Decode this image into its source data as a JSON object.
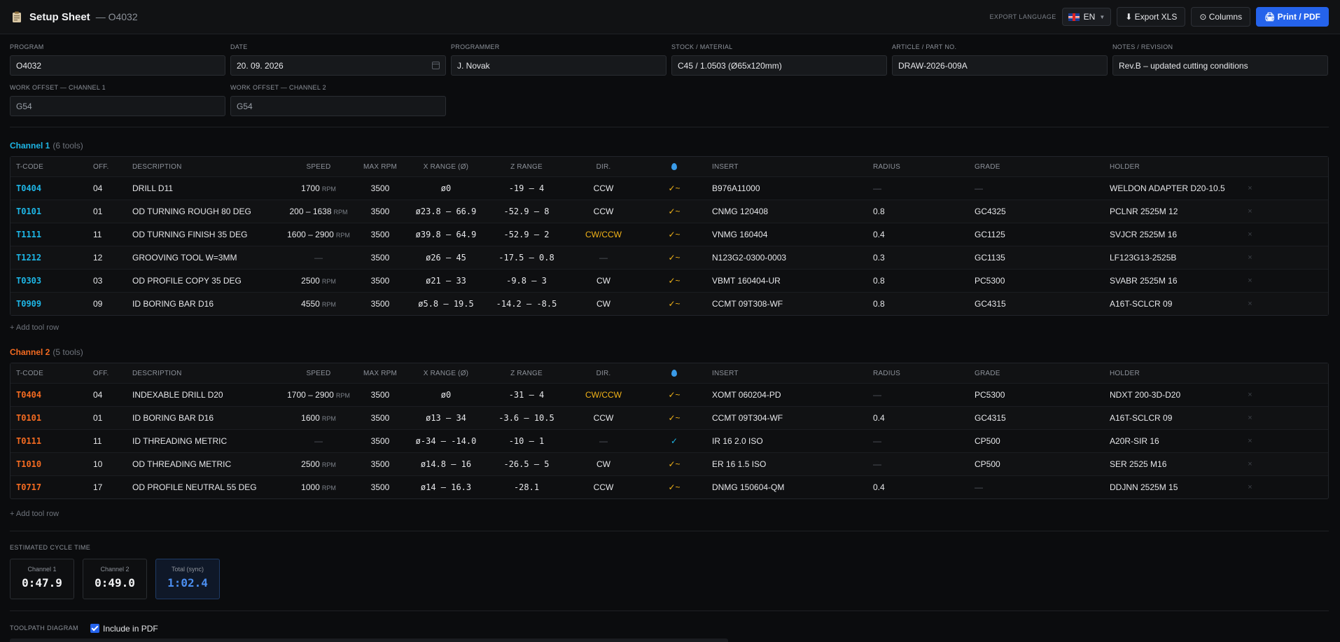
{
  "header": {
    "title": "Setup Sheet",
    "program_suffix": "— O4032",
    "export_language_label": "EXPORT LANGUAGE",
    "language": "EN",
    "export_xls": "⬇ Export XLS",
    "columns": "⊙ Columns",
    "print_pdf": "🖨 Print / PDF"
  },
  "meta": {
    "program": {
      "label": "PROGRAM",
      "value": "O4032"
    },
    "date": {
      "label": "DATE",
      "value": "20. 09. 2026"
    },
    "programmer": {
      "label": "PROGRAMMER",
      "value": "J. Novak"
    },
    "stock": {
      "label": "STOCK / MATERIAL",
      "value": "C45 / 1.0503 (Ø65x120mm)"
    },
    "article": {
      "label": "ARTICLE / PART NO.",
      "value": "DRAW-2026-009A"
    },
    "notes": {
      "label": "NOTES / REVISION",
      "value": "Rev.B – updated cutting conditions"
    },
    "wo1": {
      "label": "WORK OFFSET — CHANNEL 1",
      "value": "G54"
    },
    "wo2": {
      "label": "WORK OFFSET — CHANNEL 2",
      "value": "G54"
    }
  },
  "columns": {
    "tcode": "T-CODE",
    "off": "OFF.",
    "desc": "DESCRIPTION",
    "speed": "SPEED",
    "max_rpm": "MAX RPM",
    "xrange": "X RANGE (Ø)",
    "zrange": "Z RANGE",
    "dir": "DIR.",
    "insert": "INSERT",
    "radius": "RADIUS",
    "grade": "GRADE",
    "holder": "HOLDER"
  },
  "channel1": {
    "title": "Channel 1",
    "count": "(6 tools)",
    "add_row": "+ Add tool row",
    "rows": [
      {
        "tcode": "T0404",
        "off": "04",
        "desc": "DRILL D11",
        "speed": "1700",
        "unit": "RPM",
        "rpm": "3500",
        "xr": "ø0",
        "zr": "-19 – 4",
        "dir": "CCW",
        "cool": "✓~",
        "insert": "B976A11000",
        "radius": "—",
        "grade": "—",
        "holder": "WELDON ADAPTER D20-10.5"
      },
      {
        "tcode": "T0101",
        "off": "01",
        "desc": "OD TURNING ROUGH 80 DEG",
        "speed": "200 – 1638",
        "unit": "RPM",
        "rpm": "3500",
        "xr": "ø23.8 – 66.9",
        "zr": "-52.9 – 8",
        "dir": "CCW",
        "cool": "✓~",
        "insert": "CNMG 120408",
        "radius": "0.8",
        "grade": "GC4325",
        "holder": "PCLNR 2525M 12"
      },
      {
        "tcode": "T1111",
        "off": "11",
        "desc": "OD TURNING FINISH 35 DEG",
        "speed": "1600 – 2900",
        "unit": "RPM",
        "rpm": "3500",
        "xr": "ø39.8 – 64.9",
        "zr": "-52.9 – 2",
        "dir": "CW/CCW",
        "cool": "✓~",
        "insert": "VNMG 160404",
        "radius": "0.4",
        "grade": "GC1125",
        "holder": "SVJCR 2525M 16"
      },
      {
        "tcode": "T1212",
        "off": "12",
        "desc": "GROOVING TOOL W=3MM",
        "speed": "—",
        "unit": "",
        "rpm": "3500",
        "xr": "ø26 – 45",
        "zr": "-17.5 – 0.8",
        "dir": "—",
        "cool": "✓~",
        "insert": "N123G2-0300-0003",
        "radius": "0.3",
        "grade": "GC1135",
        "holder": "LF123G13-2525B"
      },
      {
        "tcode": "T0303",
        "off": "03",
        "desc": "OD PROFILE COPY 35 DEG",
        "speed": "2500",
        "unit": "RPM",
        "rpm": "3500",
        "xr": "ø21 – 33",
        "zr": "-9.8 – 3",
        "dir": "CW",
        "cool": "✓~",
        "insert": "VBMT 160404-UR",
        "radius": "0.8",
        "grade": "PC5300",
        "holder": "SVABR 2525M 16"
      },
      {
        "tcode": "T0909",
        "off": "09",
        "desc": "ID BORING BAR D16",
        "speed": "4550",
        "unit": "RPM",
        "rpm": "3500",
        "xr": "ø5.8 – 19.5",
        "zr": "-14.2 – -8.5",
        "dir": "CW",
        "cool": "✓~",
        "insert": "CCMT 09T308-WF",
        "radius": "0.8",
        "grade": "GC4315",
        "holder": "A16T-SCLCR 09"
      }
    ]
  },
  "channel2": {
    "title": "Channel 2",
    "count": "(5 tools)",
    "add_row": "+ Add tool row",
    "rows": [
      {
        "tcode": "T0404",
        "off": "04",
        "desc": "INDEXABLE DRILL D20",
        "speed": "1700 – 2900",
        "unit": "RPM",
        "rpm": "3500",
        "xr": "ø0",
        "zr": "-31 – 4",
        "dir": "CW/CCW",
        "cool": "✓~",
        "insert": "XOMT 060204-PD",
        "radius": "—",
        "grade": "PC5300",
        "holder": "NDXT 200-3D-D20"
      },
      {
        "tcode": "T0101",
        "off": "01",
        "desc": "ID BORING BAR D16",
        "speed": "1600",
        "unit": "RPM",
        "rpm": "3500",
        "xr": "ø13 – 34",
        "zr": "-3.6 – 10.5",
        "dir": "CCW",
        "cool": "✓~",
        "insert": "CCMT 09T304-WF",
        "radius": "0.4",
        "grade": "GC4315",
        "holder": "A16T-SCLCR 09"
      },
      {
        "tcode": "T0111",
        "off": "11",
        "desc": "ID THREADING METRIC",
        "speed": "—",
        "unit": "",
        "rpm": "3500",
        "xr": "ø-34 – -14.0",
        "zr": "-10 – 1",
        "dir": "—",
        "cool": "✓",
        "insert": "IR 16 2.0 ISO",
        "radius": "—",
        "grade": "CP500",
        "holder": "A20R-SIR 16"
      },
      {
        "tcode": "T1010",
        "off": "10",
        "desc": "OD THREADING METRIC",
        "speed": "2500",
        "unit": "RPM",
        "rpm": "3500",
        "xr": "ø14.8 – 16",
        "zr": "-26.5 – 5",
        "dir": "CW",
        "cool": "✓~",
        "insert": "ER 16 1.5 ISO",
        "radius": "—",
        "grade": "CP500",
        "holder": "SER 2525 M16"
      },
      {
        "tcode": "T0717",
        "off": "17",
        "desc": "OD PROFILE NEUTRAL 55 DEG",
        "speed": "1000",
        "unit": "RPM",
        "rpm": "3500",
        "xr": "ø14 – 16.3",
        "zr": "-28.1",
        "dir": "CCW",
        "cool": "✓~",
        "insert": "DNMG 150604-QM",
        "radius": "0.4",
        "grade": "—",
        "holder": "DDJNN 2525M 15"
      }
    ]
  },
  "cycle": {
    "label": "ESTIMATED CYCLE TIME",
    "ch1_label": "Channel 1",
    "ch1_value": "0:47.9",
    "ch2_label": "Channel 2",
    "ch2_value": "0:49.0",
    "total_label": "Total (sync)",
    "total_value": "1:02.4"
  },
  "toolpath": {
    "label": "TOOLPATH DIAGRAM",
    "include_pdf": "Include in PDF"
  },
  "colors": {
    "channel1": "#1eb6e6",
    "channel2": "#f46b21",
    "accent": "#2563eb",
    "warn": "#f2b318"
  }
}
